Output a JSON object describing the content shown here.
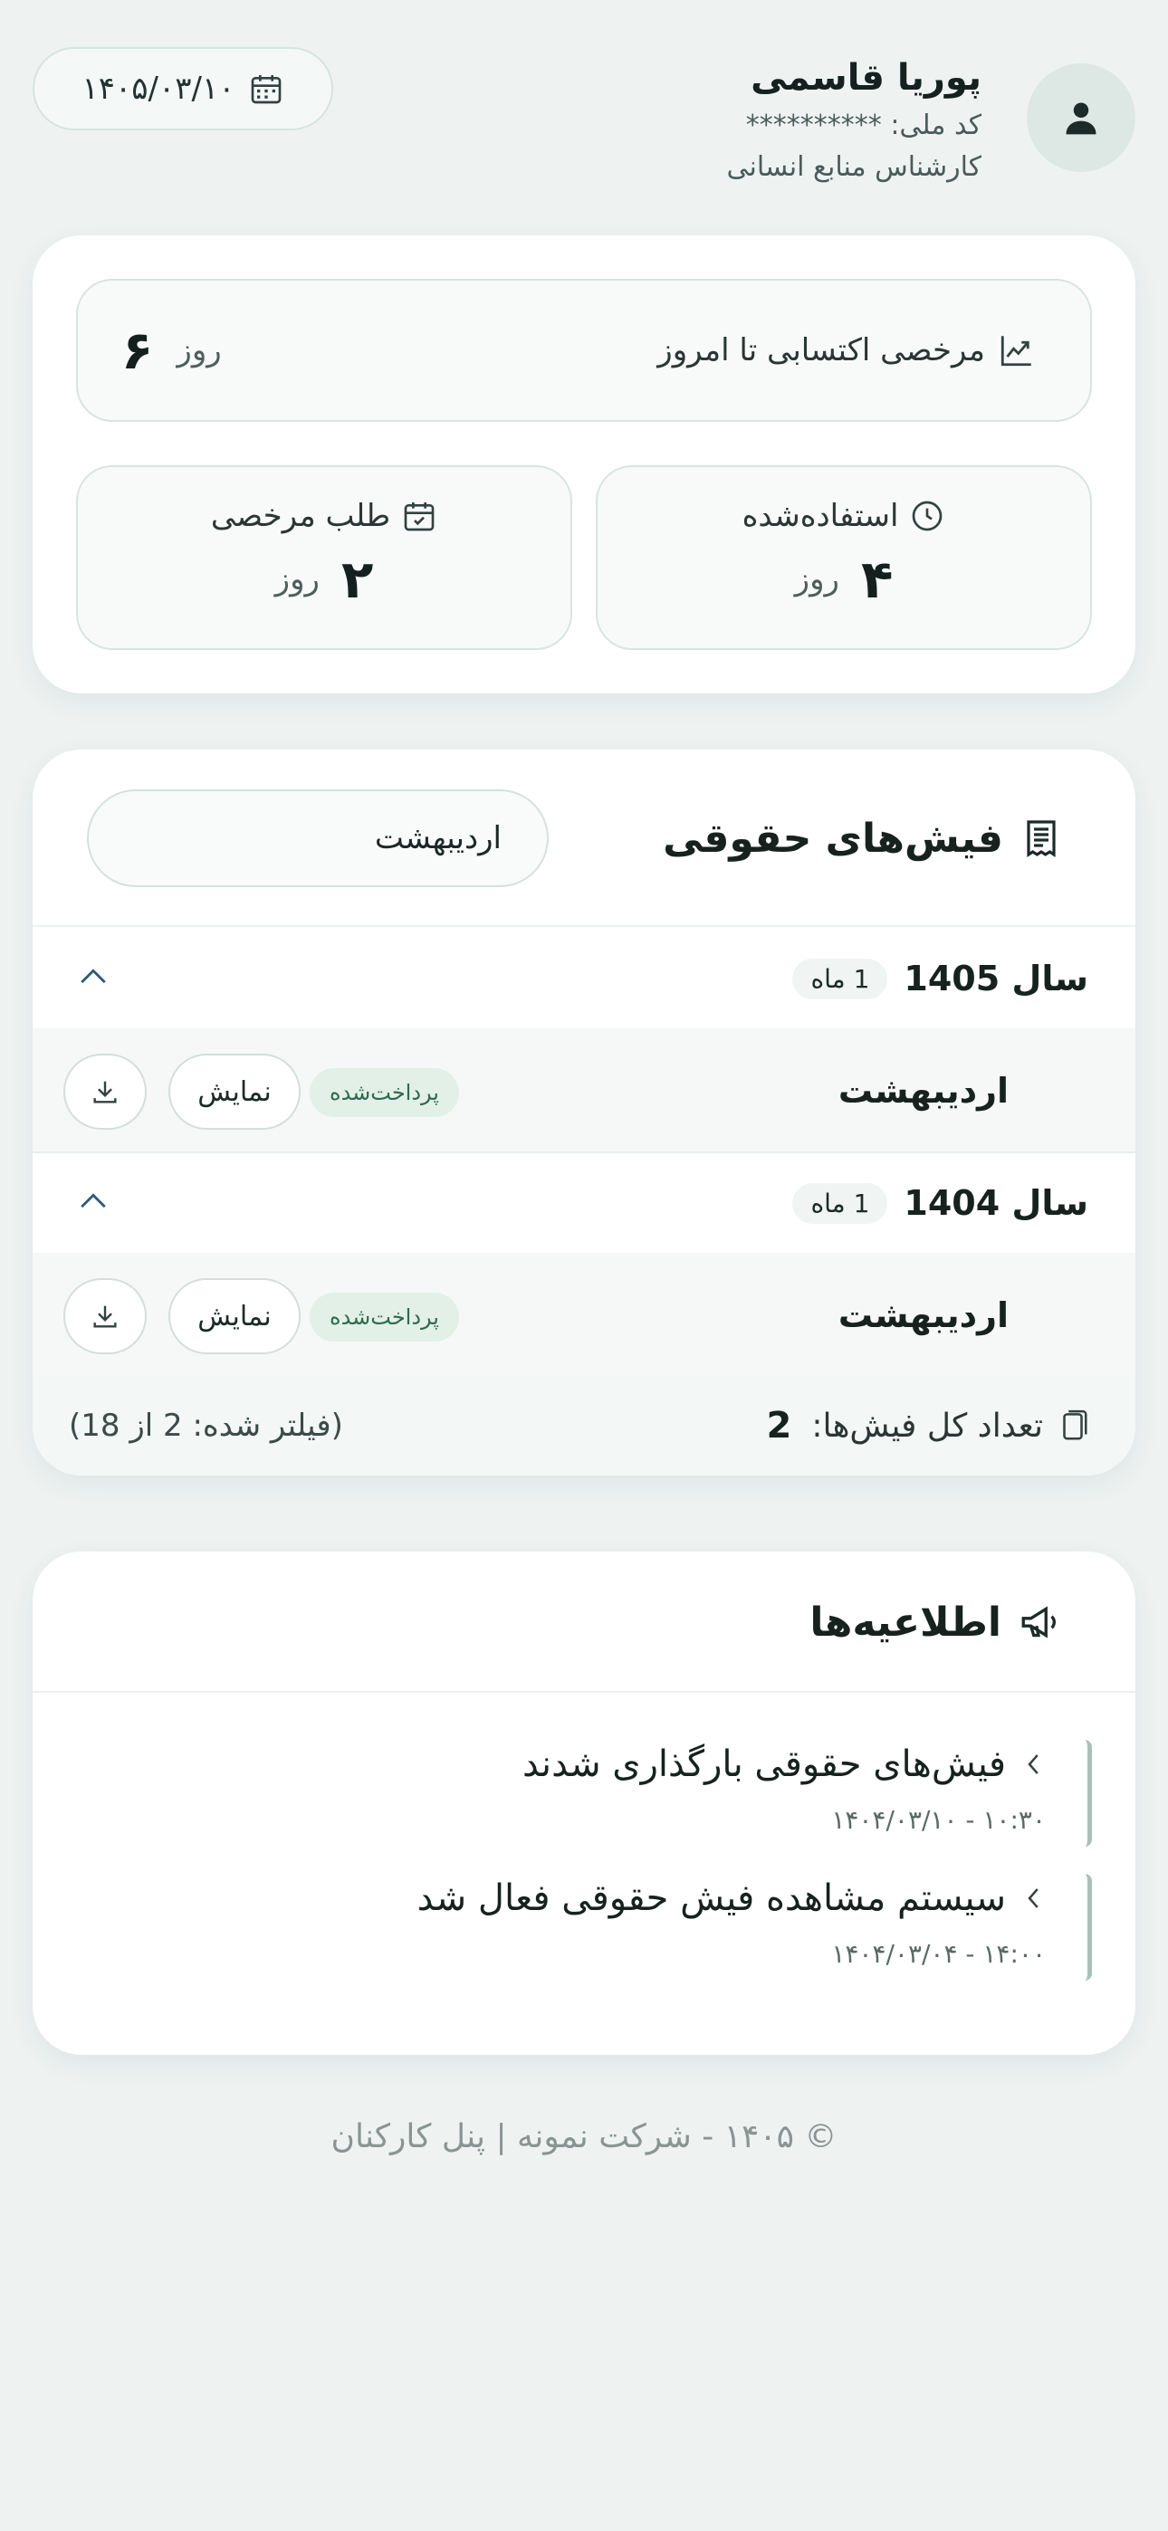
{
  "user": {
    "name": "پوریا قاسمی",
    "national_id": "کد ملی: **********",
    "role": "کارشناس منابع انسانی"
  },
  "header": {
    "date": "۱۴۰۵/۰۳/۱۰"
  },
  "leave": {
    "accrued": {
      "title": "مرخصی اکتسابی تا امروز",
      "value": "۶",
      "unit": "روز"
    },
    "used": {
      "title": "استفاده‌شده",
      "value": "۴",
      "unit": "روز"
    },
    "request": {
      "title": "طلب مرخصی",
      "value": "۲",
      "unit": "روز"
    }
  },
  "payslips": {
    "title": "فیش‌های حقوقی",
    "filter_value": "اردیبهشت",
    "years": [
      {
        "label": "سال 1405",
        "count_num": "1",
        "count_unit": "ماه",
        "items": [
          {
            "month": "اردیبهشت",
            "status": "پرداخت‌شده",
            "view": "نمایش"
          }
        ]
      },
      {
        "label": "سال 1404",
        "count_num": "1",
        "count_unit": "ماه",
        "items": [
          {
            "month": "اردیبهشت",
            "status": "پرداخت‌شده",
            "view": "نمایش"
          }
        ]
      }
    ],
    "total_label": "تعداد کل فیش‌ها:",
    "total_value": "2",
    "filtered_text": "(فیلتر شده: 2 از 18)"
  },
  "announcements": {
    "title": "اطلاعیه‌ها",
    "items": [
      {
        "title": "فیش‌های حقوقی بارگذاری شدند",
        "time": "۱۴۰۴/۰۳/۱۰ - ۱۰:۳۰"
      },
      {
        "title": "سیستم مشاهده فیش حقوقی فعال شد",
        "time": "۱۴۰۴/۰۳/۰۴ - ۱۴:۰۰"
      }
    ]
  },
  "footer": {
    "text": "© ۱۴۰۵ - شرکت نمونه | پنل کارکنان"
  },
  "colors": {
    "background": "#eef3f2",
    "card": "#ffffff",
    "badge_bg": "#e2f0e8",
    "badge_text": "#2f6a4c",
    "accent_line": "#a9c0b8"
  }
}
